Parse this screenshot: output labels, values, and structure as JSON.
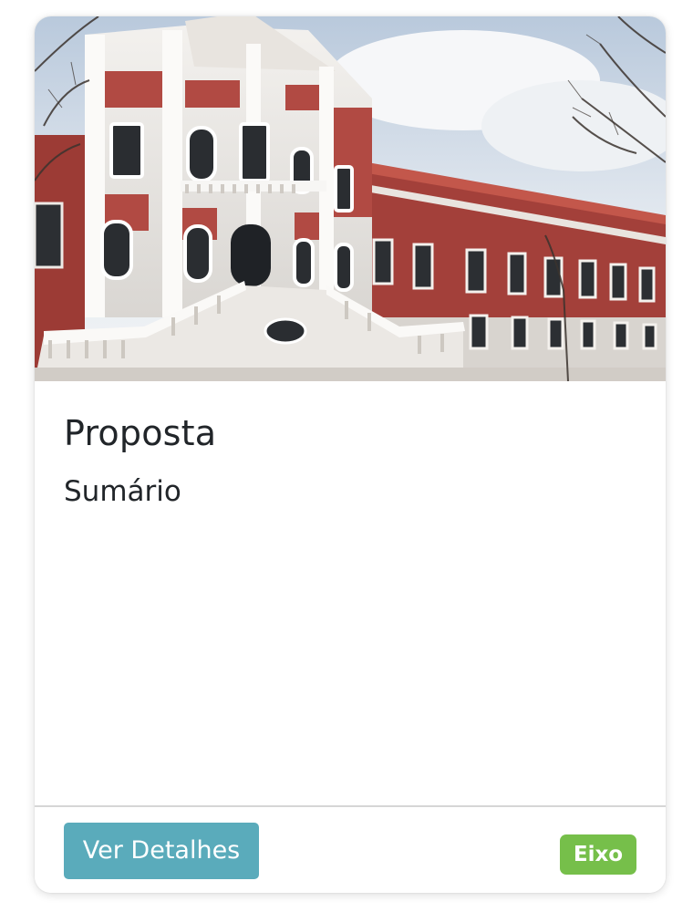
{
  "card": {
    "image_alt": "Palácio neoclássico branco e vermelho com escadaria",
    "title": "Proposta",
    "subtitle": "Sumário",
    "details_button_label": "Ver Detalhes",
    "badge_label": "Eixo"
  },
  "colors": {
    "button": "#5aabbb",
    "badge": "#76bf4a",
    "text": "#212529"
  }
}
